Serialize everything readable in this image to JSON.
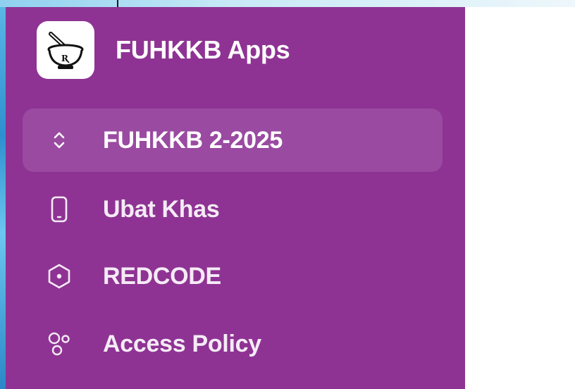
{
  "app": {
    "title": "FUHKKB Apps",
    "logo_icon": "mortar-pestle-rx-icon"
  },
  "sidebar": {
    "items": [
      {
        "label": "FUHKKB 2-2025",
        "icon": "chevron-up-down-icon",
        "active": true
      },
      {
        "label": "Ubat Khas",
        "icon": "phone-icon",
        "active": false
      },
      {
        "label": "REDCODE",
        "icon": "hexagon-icon",
        "active": false
      },
      {
        "label": "Access Policy",
        "icon": "circles-network-icon",
        "active": false
      }
    ]
  },
  "colors": {
    "sidebar_bg": "#8e3393",
    "active_item_bg": "#9a4aa1",
    "text": "#ffffff"
  }
}
